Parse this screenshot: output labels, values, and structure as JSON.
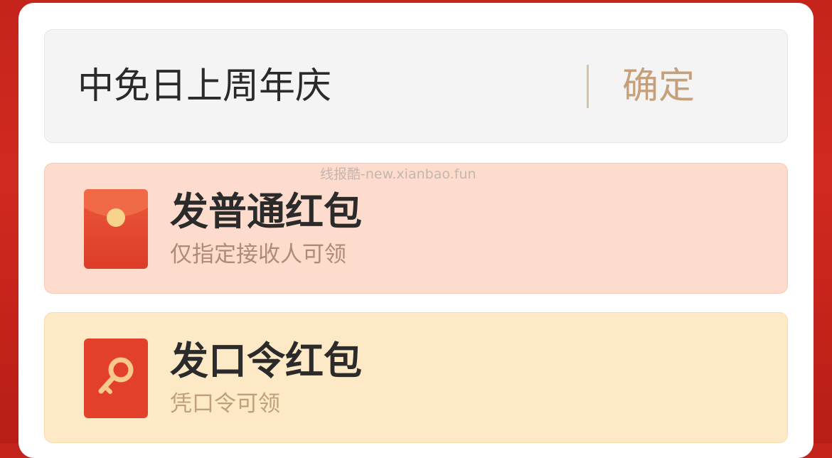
{
  "input": {
    "value": "中免日上周年庆",
    "confirm_label": "确定"
  },
  "options": [
    {
      "title": "发普通红包",
      "subtitle": "仅指定接收人可领",
      "icon": "red-envelope-icon"
    },
    {
      "title": "发口令红包",
      "subtitle": "凭口令可领",
      "icon": "key-icon"
    }
  ],
  "watermark": "线报酷-new.xianbao.fun",
  "colors": {
    "brand_red": "#d12a20",
    "confirm_gold": "#c6a07a",
    "normal_card_bg": "#fddccd",
    "pass_card_bg": "#fde9c6"
  }
}
